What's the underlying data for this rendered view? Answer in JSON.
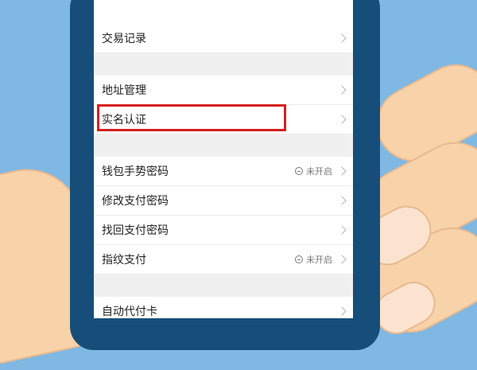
{
  "menu": {
    "section1": [
      {
        "label": "交易记录",
        "status": ""
      }
    ],
    "section2": [
      {
        "label": "地址管理",
        "status": ""
      },
      {
        "label": "实名认证",
        "status": ""
      }
    ],
    "section3": [
      {
        "label": "钱包手势密码",
        "status": "未开启"
      },
      {
        "label": "修改支付密码",
        "status": ""
      },
      {
        "label": "找回支付密码",
        "status": ""
      },
      {
        "label": "指纹支付",
        "status": "未开启"
      }
    ],
    "section4": [
      {
        "label": "自动代付卡",
        "status": ""
      }
    ]
  },
  "colors": {
    "background": "#7fb8e3",
    "phone_frame": "#174e79",
    "highlight_border": "#d51f1f"
  }
}
